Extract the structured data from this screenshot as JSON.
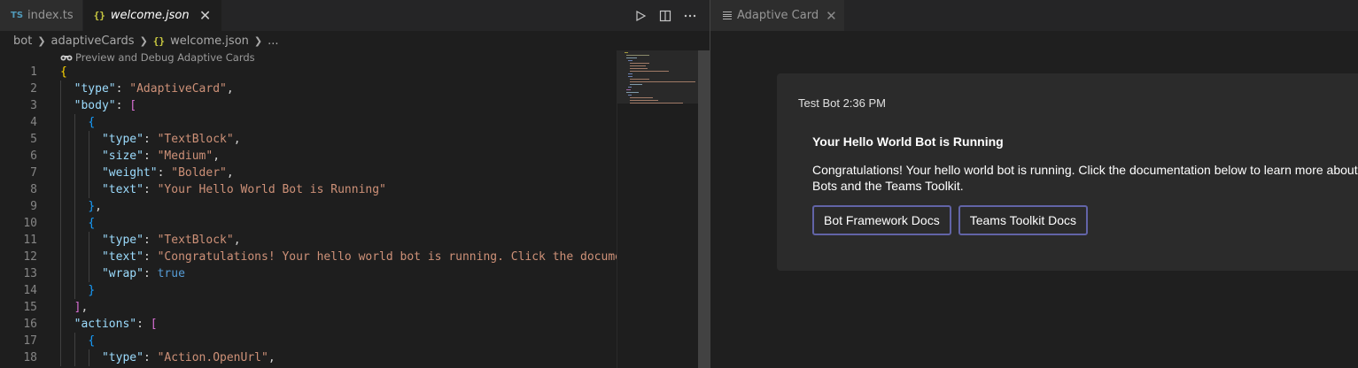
{
  "editor": {
    "tabs": [
      {
        "icon": "TS",
        "label": "index.ts"
      },
      {
        "icon": "{}",
        "label": "welcome.json",
        "close": "✕"
      }
    ],
    "breadcrumb": [
      "bot",
      "adaptiveCards",
      "welcome.json",
      "..."
    ],
    "codelens": "Preview and Debug Adaptive Cards",
    "line_numbers": [
      "1",
      "2",
      "3",
      "4",
      "5",
      "6",
      "7",
      "8",
      "9",
      "10",
      "11",
      "12",
      "13",
      "14",
      "15",
      "16",
      "17",
      "18"
    ],
    "code": {
      "l2_key": "\"type\"",
      "l2_val": "\"AdaptiveCard\"",
      "l3_key": "\"body\"",
      "l5_key": "\"type\"",
      "l5_val": "\"TextBlock\"",
      "l6_key": "\"size\"",
      "l6_val": "\"Medium\"",
      "l7_key": "\"weight\"",
      "l7_val": "\"Bolder\"",
      "l8_key": "\"text\"",
      "l8_val": "\"Your Hello World Bot is Running\"",
      "l11_key": "\"type\"",
      "l11_val": "\"TextBlock\"",
      "l12_key": "\"text\"",
      "l12_val": "\"Congratulations! Your hello world bot is running. Click the documen",
      "l13_key": "\"wrap\"",
      "l13_val": "true",
      "l16_key": "\"actions\"",
      "l18_key": "\"type\"",
      "l18_val": "\"Action.OpenUrl\""
    }
  },
  "preview": {
    "tab_label": "Adaptive Card",
    "tab_close": "✕",
    "card": {
      "sender": "Test Bot 2:36 PM",
      "title": "Your Hello World Bot is Running",
      "body": "Congratulations! Your hello world bot is running. Click the documentation below to learn more about Bots and the Teams Toolkit.",
      "actions": [
        "Bot Framework Docs",
        "Teams Toolkit Docs"
      ]
    }
  },
  "colors": {
    "button_border": "#6264a7",
    "json_key": "#9cdcfe",
    "json_string": "#ce9178"
  }
}
